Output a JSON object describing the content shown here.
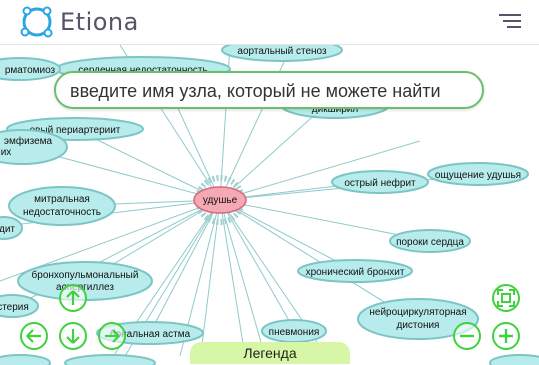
{
  "app": {
    "brand": "Etiona",
    "menu_icon": "hamburger-icon"
  },
  "search": {
    "placeholder": "введите имя узла, который не можете найти"
  },
  "graph": {
    "center": "удушье",
    "nodes": [
      "аортальный стеноз",
      "сердечная недостаточность",
      "рматомиоз",
      "дикширил",
      "овый периартериит",
      "эмфизема",
      "их",
      "острый нефрит",
      "ощущение удушья",
      "митральная недостаточность",
      "дит",
      "пороки сердца",
      "хронический бронхит",
      "бронхопульмональный аспергиллез",
      "стерия",
      "нейроциркуляторная дистония",
      "пневмония",
      "бональная астма"
    ]
  },
  "controls": {
    "up": "arrow-up-icon",
    "left": "arrow-left-icon",
    "down": "arrow-down-icon",
    "right": "arrow-right-icon",
    "fit": "fit-screen-icon",
    "zoom_out": "minus-icon",
    "zoom_in": "plus-icon"
  },
  "legend": {
    "label": "Легенда"
  },
  "colors": {
    "node_fill": "#b8ecec",
    "node_stroke": "#7cc5c5",
    "edge": "#8fcaca",
    "center_fill": "#f4a9b4",
    "control_green": "#3ed23e",
    "legend_bg": "#d8f7a6"
  }
}
